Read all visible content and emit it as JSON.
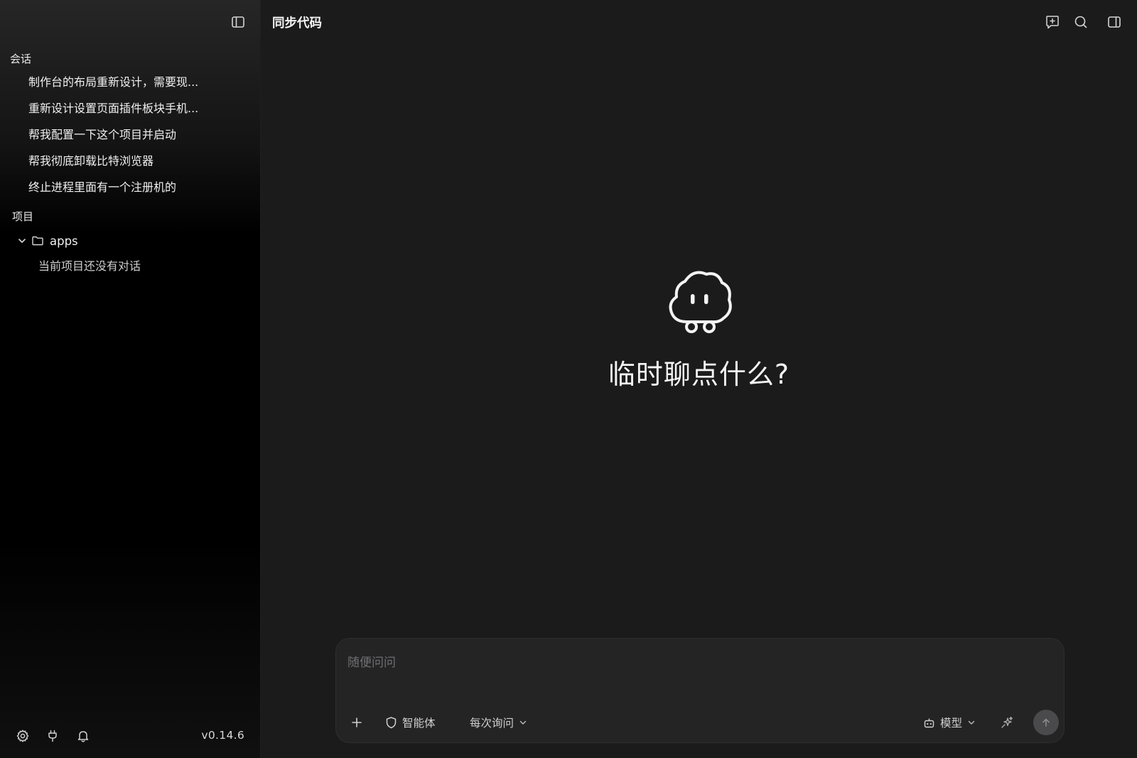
{
  "sidebar": {
    "conversations_label": "会话",
    "conversations": [
      {
        "label": "制作台的布局重新设计，需要现..."
      },
      {
        "label": "重新设计设置页面插件板块手机..."
      },
      {
        "label": "帮我配置一下这个项目并启动"
      },
      {
        "label": "帮我彻底卸载比特浏览器"
      },
      {
        "label": "终止进程里面有一个注册机的"
      }
    ],
    "projects_label": "项目",
    "project": {
      "name": "apps",
      "empty_text": "当前项目还没有对话"
    },
    "version": "v0.14.6",
    "footer_icons": [
      "gear-icon",
      "plug-icon",
      "bell-icon"
    ]
  },
  "header": {
    "title": "同步代码",
    "icons": [
      "new-chat-icon",
      "search-icon",
      "right-panel-icon"
    ]
  },
  "hero": {
    "text": "临时聊点什么?"
  },
  "composer": {
    "placeholder": "随便问问",
    "agent_label": "智能体",
    "permission_label": "每次询问",
    "model_label": "模型"
  },
  "colors": {
    "background": "#1b1b1c",
    "sidebar": "#000000",
    "composer": "#242425",
    "send_button": "#4a4a4c"
  }
}
